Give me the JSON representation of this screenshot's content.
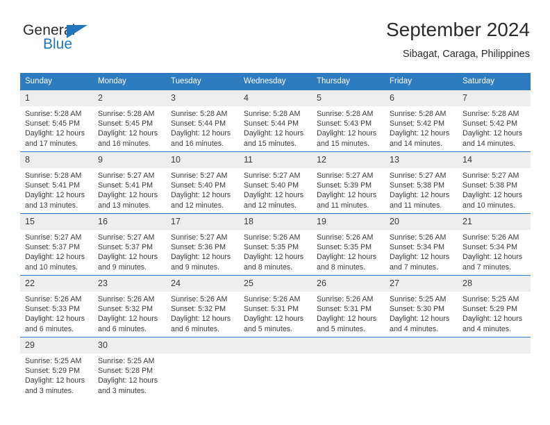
{
  "brand": {
    "name_top": "General",
    "name_bottom": "Blue",
    "triangle_color": "#1f76bc",
    "text_color": "#2b2b2b"
  },
  "header": {
    "title": "September 2024",
    "subtitle": "Sibagat, Caraga, Philippines"
  },
  "theme": {
    "header_blue": "#2e7cbf",
    "daynum_band": "#eeeeee",
    "text": "#3a3a3a"
  },
  "calendar": {
    "weekday_headers": [
      "Sunday",
      "Monday",
      "Tuesday",
      "Wednesday",
      "Thursday",
      "Friday",
      "Saturday"
    ],
    "weeks": [
      [
        {
          "day": "1",
          "sunrise": "Sunrise: 5:28 AM",
          "sunset": "Sunset: 5:45 PM",
          "daylight_1": "Daylight: 12 hours",
          "daylight_2": "and 17 minutes."
        },
        {
          "day": "2",
          "sunrise": "Sunrise: 5:28 AM",
          "sunset": "Sunset: 5:45 PM",
          "daylight_1": "Daylight: 12 hours",
          "daylight_2": "and 16 minutes."
        },
        {
          "day": "3",
          "sunrise": "Sunrise: 5:28 AM",
          "sunset": "Sunset: 5:44 PM",
          "daylight_1": "Daylight: 12 hours",
          "daylight_2": "and 16 minutes."
        },
        {
          "day": "4",
          "sunrise": "Sunrise: 5:28 AM",
          "sunset": "Sunset: 5:44 PM",
          "daylight_1": "Daylight: 12 hours",
          "daylight_2": "and 15 minutes."
        },
        {
          "day": "5",
          "sunrise": "Sunrise: 5:28 AM",
          "sunset": "Sunset: 5:43 PM",
          "daylight_1": "Daylight: 12 hours",
          "daylight_2": "and 15 minutes."
        },
        {
          "day": "6",
          "sunrise": "Sunrise: 5:28 AM",
          "sunset": "Sunset: 5:42 PM",
          "daylight_1": "Daylight: 12 hours",
          "daylight_2": "and 14 minutes."
        },
        {
          "day": "7",
          "sunrise": "Sunrise: 5:28 AM",
          "sunset": "Sunset: 5:42 PM",
          "daylight_1": "Daylight: 12 hours",
          "daylight_2": "and 14 minutes."
        }
      ],
      [
        {
          "day": "8",
          "sunrise": "Sunrise: 5:28 AM",
          "sunset": "Sunset: 5:41 PM",
          "daylight_1": "Daylight: 12 hours",
          "daylight_2": "and 13 minutes."
        },
        {
          "day": "9",
          "sunrise": "Sunrise: 5:27 AM",
          "sunset": "Sunset: 5:41 PM",
          "daylight_1": "Daylight: 12 hours",
          "daylight_2": "and 13 minutes."
        },
        {
          "day": "10",
          "sunrise": "Sunrise: 5:27 AM",
          "sunset": "Sunset: 5:40 PM",
          "daylight_1": "Daylight: 12 hours",
          "daylight_2": "and 12 minutes."
        },
        {
          "day": "11",
          "sunrise": "Sunrise: 5:27 AM",
          "sunset": "Sunset: 5:40 PM",
          "daylight_1": "Daylight: 12 hours",
          "daylight_2": "and 12 minutes."
        },
        {
          "day": "12",
          "sunrise": "Sunrise: 5:27 AM",
          "sunset": "Sunset: 5:39 PM",
          "daylight_1": "Daylight: 12 hours",
          "daylight_2": "and 11 minutes."
        },
        {
          "day": "13",
          "sunrise": "Sunrise: 5:27 AM",
          "sunset": "Sunset: 5:38 PM",
          "daylight_1": "Daylight: 12 hours",
          "daylight_2": "and 11 minutes."
        },
        {
          "day": "14",
          "sunrise": "Sunrise: 5:27 AM",
          "sunset": "Sunset: 5:38 PM",
          "daylight_1": "Daylight: 12 hours",
          "daylight_2": "and 10 minutes."
        }
      ],
      [
        {
          "day": "15",
          "sunrise": "Sunrise: 5:27 AM",
          "sunset": "Sunset: 5:37 PM",
          "daylight_1": "Daylight: 12 hours",
          "daylight_2": "and 10 minutes."
        },
        {
          "day": "16",
          "sunrise": "Sunrise: 5:27 AM",
          "sunset": "Sunset: 5:37 PM",
          "daylight_1": "Daylight: 12 hours",
          "daylight_2": "and 9 minutes."
        },
        {
          "day": "17",
          "sunrise": "Sunrise: 5:27 AM",
          "sunset": "Sunset: 5:36 PM",
          "daylight_1": "Daylight: 12 hours",
          "daylight_2": "and 9 minutes."
        },
        {
          "day": "18",
          "sunrise": "Sunrise: 5:26 AM",
          "sunset": "Sunset: 5:35 PM",
          "daylight_1": "Daylight: 12 hours",
          "daylight_2": "and 8 minutes."
        },
        {
          "day": "19",
          "sunrise": "Sunrise: 5:26 AM",
          "sunset": "Sunset: 5:35 PM",
          "daylight_1": "Daylight: 12 hours",
          "daylight_2": "and 8 minutes."
        },
        {
          "day": "20",
          "sunrise": "Sunrise: 5:26 AM",
          "sunset": "Sunset: 5:34 PM",
          "daylight_1": "Daylight: 12 hours",
          "daylight_2": "and 7 minutes."
        },
        {
          "day": "21",
          "sunrise": "Sunrise: 5:26 AM",
          "sunset": "Sunset: 5:34 PM",
          "daylight_1": "Daylight: 12 hours",
          "daylight_2": "and 7 minutes."
        }
      ],
      [
        {
          "day": "22",
          "sunrise": "Sunrise: 5:26 AM",
          "sunset": "Sunset: 5:33 PM",
          "daylight_1": "Daylight: 12 hours",
          "daylight_2": "and 6 minutes."
        },
        {
          "day": "23",
          "sunrise": "Sunrise: 5:26 AM",
          "sunset": "Sunset: 5:32 PM",
          "daylight_1": "Daylight: 12 hours",
          "daylight_2": "and 6 minutes."
        },
        {
          "day": "24",
          "sunrise": "Sunrise: 5:26 AM",
          "sunset": "Sunset: 5:32 PM",
          "daylight_1": "Daylight: 12 hours",
          "daylight_2": "and 6 minutes."
        },
        {
          "day": "25",
          "sunrise": "Sunrise: 5:26 AM",
          "sunset": "Sunset: 5:31 PM",
          "daylight_1": "Daylight: 12 hours",
          "daylight_2": "and 5 minutes."
        },
        {
          "day": "26",
          "sunrise": "Sunrise: 5:26 AM",
          "sunset": "Sunset: 5:31 PM",
          "daylight_1": "Daylight: 12 hours",
          "daylight_2": "and 5 minutes."
        },
        {
          "day": "27",
          "sunrise": "Sunrise: 5:25 AM",
          "sunset": "Sunset: 5:30 PM",
          "daylight_1": "Daylight: 12 hours",
          "daylight_2": "and 4 minutes."
        },
        {
          "day": "28",
          "sunrise": "Sunrise: 5:25 AM",
          "sunset": "Sunset: 5:29 PM",
          "daylight_1": "Daylight: 12 hours",
          "daylight_2": "and 4 minutes."
        }
      ],
      [
        {
          "day": "29",
          "sunrise": "Sunrise: 5:25 AM",
          "sunset": "Sunset: 5:29 PM",
          "daylight_1": "Daylight: 12 hours",
          "daylight_2": "and 3 minutes."
        },
        {
          "day": "30",
          "sunrise": "Sunrise: 5:25 AM",
          "sunset": "Sunset: 5:28 PM",
          "daylight_1": "Daylight: 12 hours",
          "daylight_2": "and 3 minutes."
        },
        {
          "day": "",
          "sunrise": "",
          "sunset": "",
          "daylight_1": "",
          "daylight_2": ""
        },
        {
          "day": "",
          "sunrise": "",
          "sunset": "",
          "daylight_1": "",
          "daylight_2": ""
        },
        {
          "day": "",
          "sunrise": "",
          "sunset": "",
          "daylight_1": "",
          "daylight_2": ""
        },
        {
          "day": "",
          "sunrise": "",
          "sunset": "",
          "daylight_1": "",
          "daylight_2": ""
        },
        {
          "day": "",
          "sunrise": "",
          "sunset": "",
          "daylight_1": "",
          "daylight_2": ""
        }
      ]
    ]
  }
}
